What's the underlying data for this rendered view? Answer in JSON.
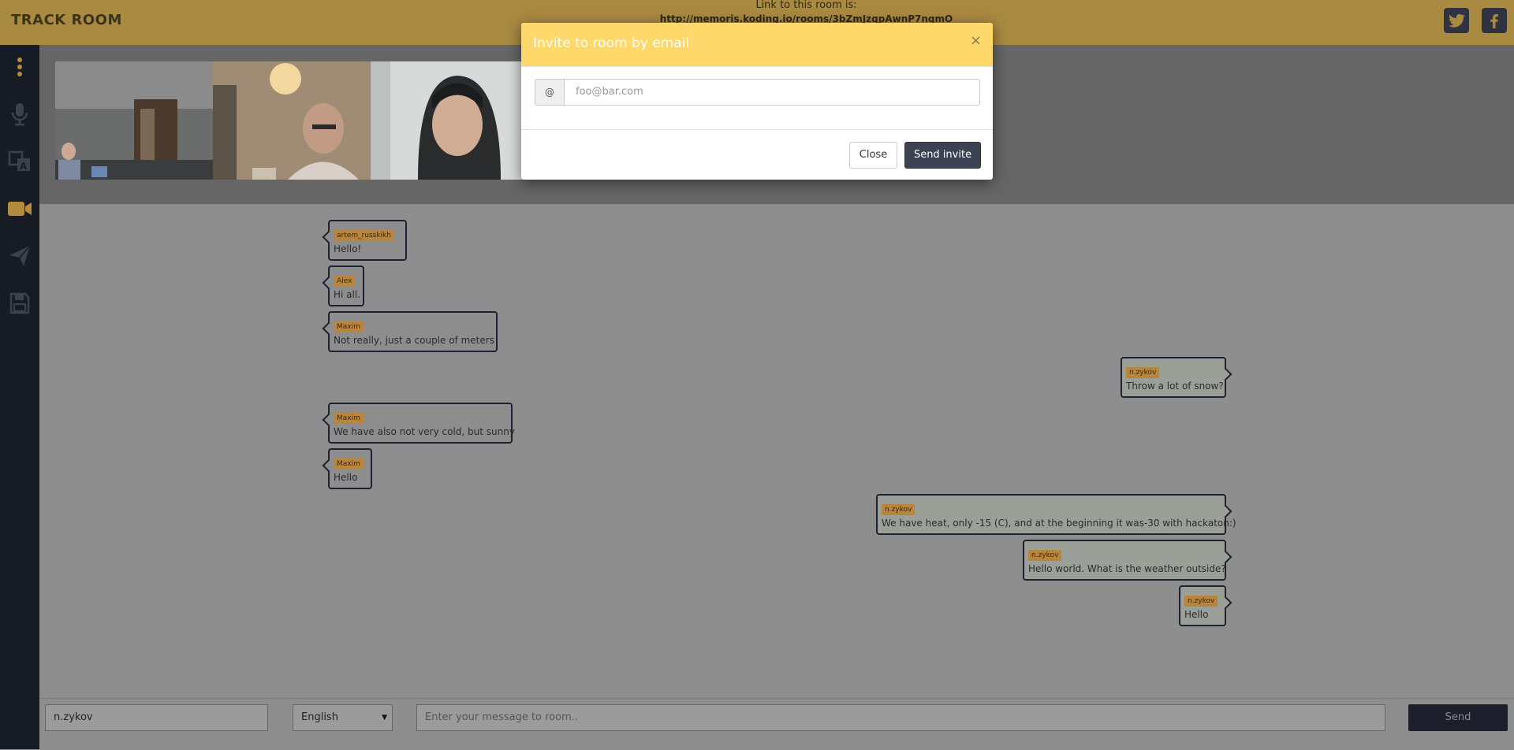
{
  "header": {
    "brand": "TRACK ROOM",
    "link_label": "Link to this room is:",
    "link_url": "http://memoris.koding.io/rooms/3bZmJzqpAwnP7nqmO"
  },
  "sidebar": {
    "icons": [
      "more-vertical-icon",
      "microphone-icon",
      "translate-icon",
      "video-camera-icon",
      "send-icon",
      "save-icon"
    ]
  },
  "social": [
    "twitter-icon",
    "facebook-icon"
  ],
  "messages": [
    {
      "side": "left",
      "name": "artem_russkikh",
      "text": "Hello!"
    },
    {
      "side": "left",
      "name": "Alex",
      "text": "Hi all."
    },
    {
      "side": "left",
      "name": "Maxim",
      "text": "Not really, just a couple of meters"
    },
    {
      "side": "right",
      "name": "n.zykov",
      "text": "Throw a lot of snow?"
    },
    {
      "side": "left",
      "name": "Maxim",
      "text": "We have also not very cold, but sunny"
    },
    {
      "side": "left",
      "name": "Maxim",
      "text": "Hello"
    },
    {
      "side": "right",
      "name": "n.zykov",
      "text": "We have heat, only -15 (C), and at the beginning it was-30 with hackaton:)"
    },
    {
      "side": "right",
      "name": "n.zykov",
      "text": "Hello world. What is the weather outside?"
    },
    {
      "side": "right",
      "name": "n.zykov",
      "text": "Hello"
    }
  ],
  "bottom": {
    "username": "n.zykov",
    "language": "English",
    "message_placeholder": "Enter your message to room..",
    "send_label": "Send"
  },
  "modal": {
    "title": "Invite to room by email",
    "close_glyph": "×",
    "addon": "@",
    "email_placeholder": "foo@bar.com",
    "close_label": "Close",
    "send_label": "Send invite"
  }
}
